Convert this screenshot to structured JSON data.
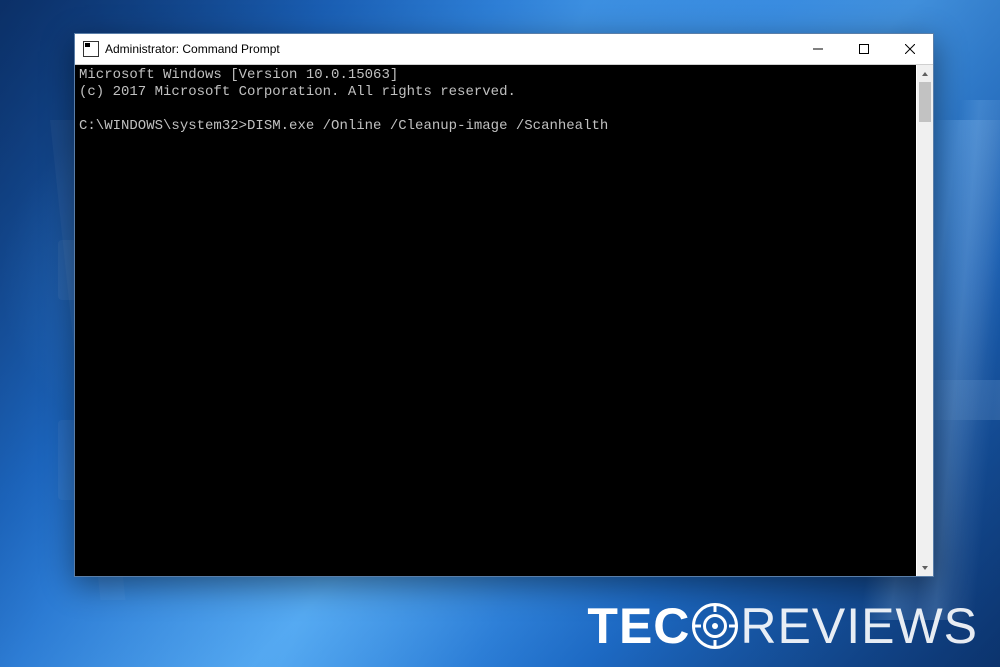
{
  "window": {
    "title": "Administrator: Command Prompt"
  },
  "terminal": {
    "line1": "Microsoft Windows [Version 10.0.15063]",
    "line2": "(c) 2017 Microsoft Corporation. All rights reserved.",
    "blank": "",
    "prompt": "C:\\WINDOWS\\system32>",
    "command": "DISM.exe /Online /Cleanup-image /Scanhealth"
  },
  "watermark": {
    "part1": "TEC",
    "part2": "REVIEWS"
  }
}
